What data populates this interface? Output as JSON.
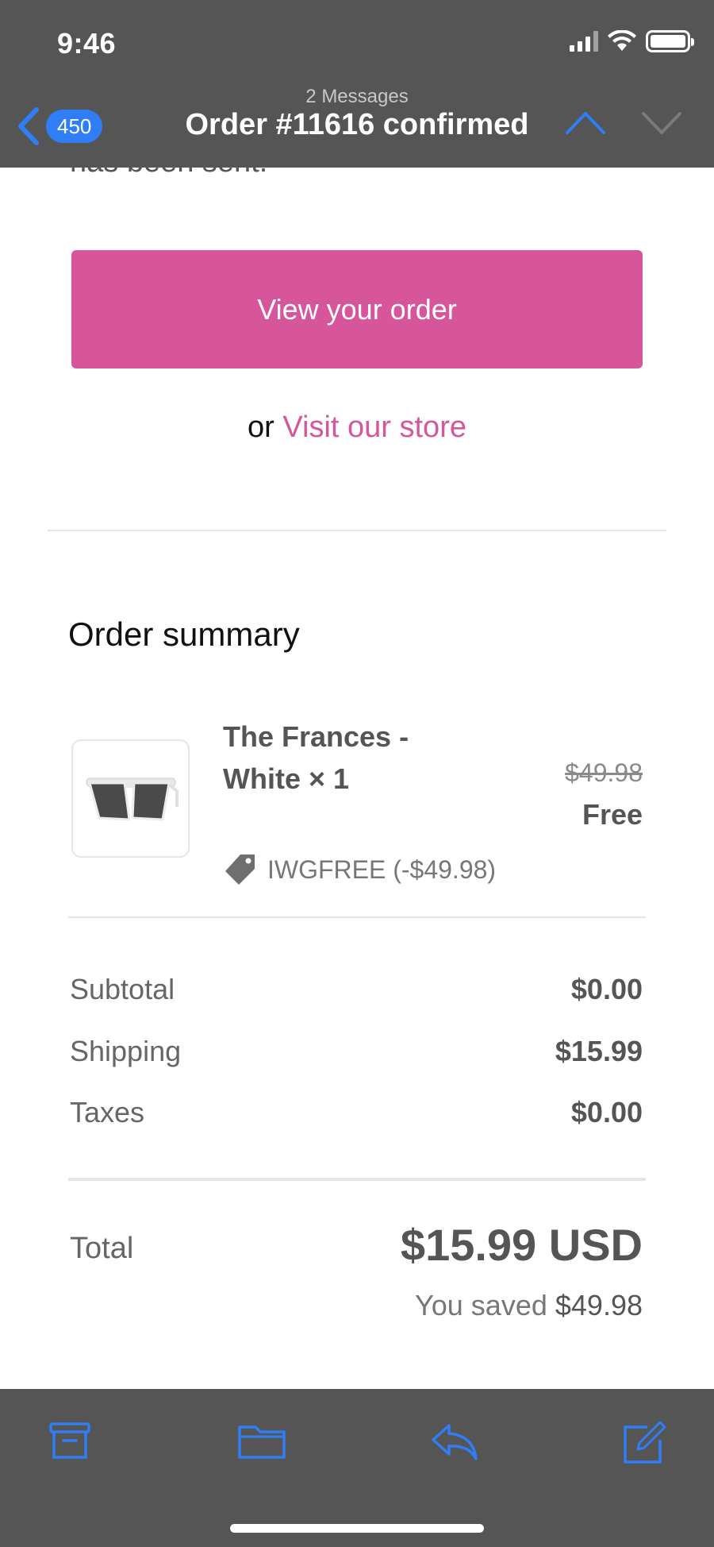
{
  "status_bar": {
    "time": "9:46"
  },
  "nav": {
    "back_count": "450",
    "messages_count": "2 Messages",
    "title": "Order #11616 confirmed"
  },
  "email": {
    "cut_text": "has been sent.",
    "view_order_label": "View your order",
    "or_text": "or",
    "visit_store_label": "Visit our store",
    "summary_title": "Order summary",
    "item": {
      "name": "The Frances - White × 1",
      "original_price": "$49.98",
      "price": "Free",
      "discount_code": "IWGFREE (-$49.98)"
    },
    "totals": {
      "subtotal_label": "Subtotal",
      "subtotal_value": "$0.00",
      "shipping_label": "Shipping",
      "shipping_value": "$15.99",
      "taxes_label": "Taxes",
      "taxes_value": "$0.00",
      "total_label": "Total",
      "total_value": "$15.99 USD",
      "saved_label": "You saved",
      "saved_value": "$49.98"
    }
  },
  "toolbar": {
    "icons": [
      "archive-icon",
      "folder-icon",
      "reply-icon",
      "compose-icon"
    ]
  },
  "colors": {
    "accent": "#d6559b",
    "ios_blue": "#2f7ef6",
    "bars": "#555555"
  }
}
